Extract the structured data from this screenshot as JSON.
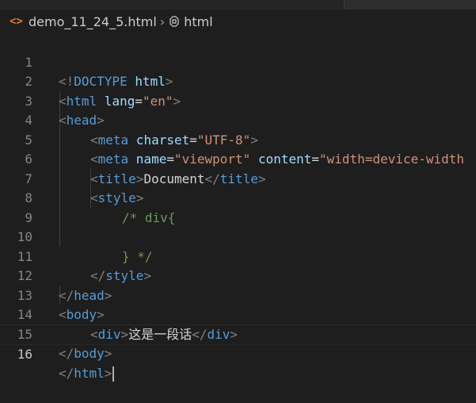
{
  "breadcrumb": {
    "file_icon": "<>",
    "file_name": "demo_11_24_5.html",
    "separator": "›",
    "symbol_icon": "html-element-icon",
    "symbol": "html"
  },
  "line_numbers": [
    "1",
    "2",
    "3",
    "4",
    "5",
    "6",
    "7",
    "8",
    "9",
    "10",
    "11",
    "12",
    "13",
    "14",
    "15",
    "16"
  ],
  "code": {
    "l1": {
      "a": "<!",
      "b": "DOCTYPE",
      "c": " html",
      "d": ">"
    },
    "l2": {
      "a": "<",
      "b": "html",
      "c": " lang",
      "d": "=",
      "e": "\"en\"",
      "f": ">"
    },
    "l3": {
      "a": "<",
      "b": "head",
      "c": ">"
    },
    "l4": {
      "a": "<",
      "b": "meta",
      "c": " charset",
      "d": "=",
      "e": "\"UTF-8\"",
      "f": ">"
    },
    "l5": {
      "a": "<",
      "b": "meta",
      "c": " name",
      "d": "=",
      "e": "\"viewport\"",
      "f": " content",
      "g": "=",
      "h": "\"width=device-width"
    },
    "l6": {
      "a": "<",
      "b": "title",
      "c": ">",
      "d": "Document",
      "e": "</",
      "f": "title",
      "g": ">"
    },
    "l7": {
      "a": "<",
      "b": "style",
      "c": ">"
    },
    "l8": {
      "a": "/* div{"
    },
    "l9": {
      "a": ""
    },
    "l10": {
      "a": "} */"
    },
    "l11": {
      "a": "</",
      "b": "style",
      "c": ">"
    },
    "l12": {
      "a": "</",
      "b": "head",
      "c": ">"
    },
    "l13": {
      "a": "<",
      "b": "body",
      "c": ">"
    },
    "l14": {
      "a": "<",
      "b": "div",
      "c": ">",
      "d": "这是一段话",
      "e": "</",
      "f": "div",
      "g": ">"
    },
    "l15": {
      "a": "</",
      "b": "body",
      "c": ">"
    },
    "l16": {
      "a": "</",
      "b": "html",
      "c": ">"
    }
  },
  "active_line": 16,
  "colors": {
    "background": "#1e1e1e",
    "tag": "#569cd6",
    "attribute": "#9cdcfe",
    "string": "#ce9178",
    "comment": "#6a9955",
    "punctuation": "#808080"
  }
}
